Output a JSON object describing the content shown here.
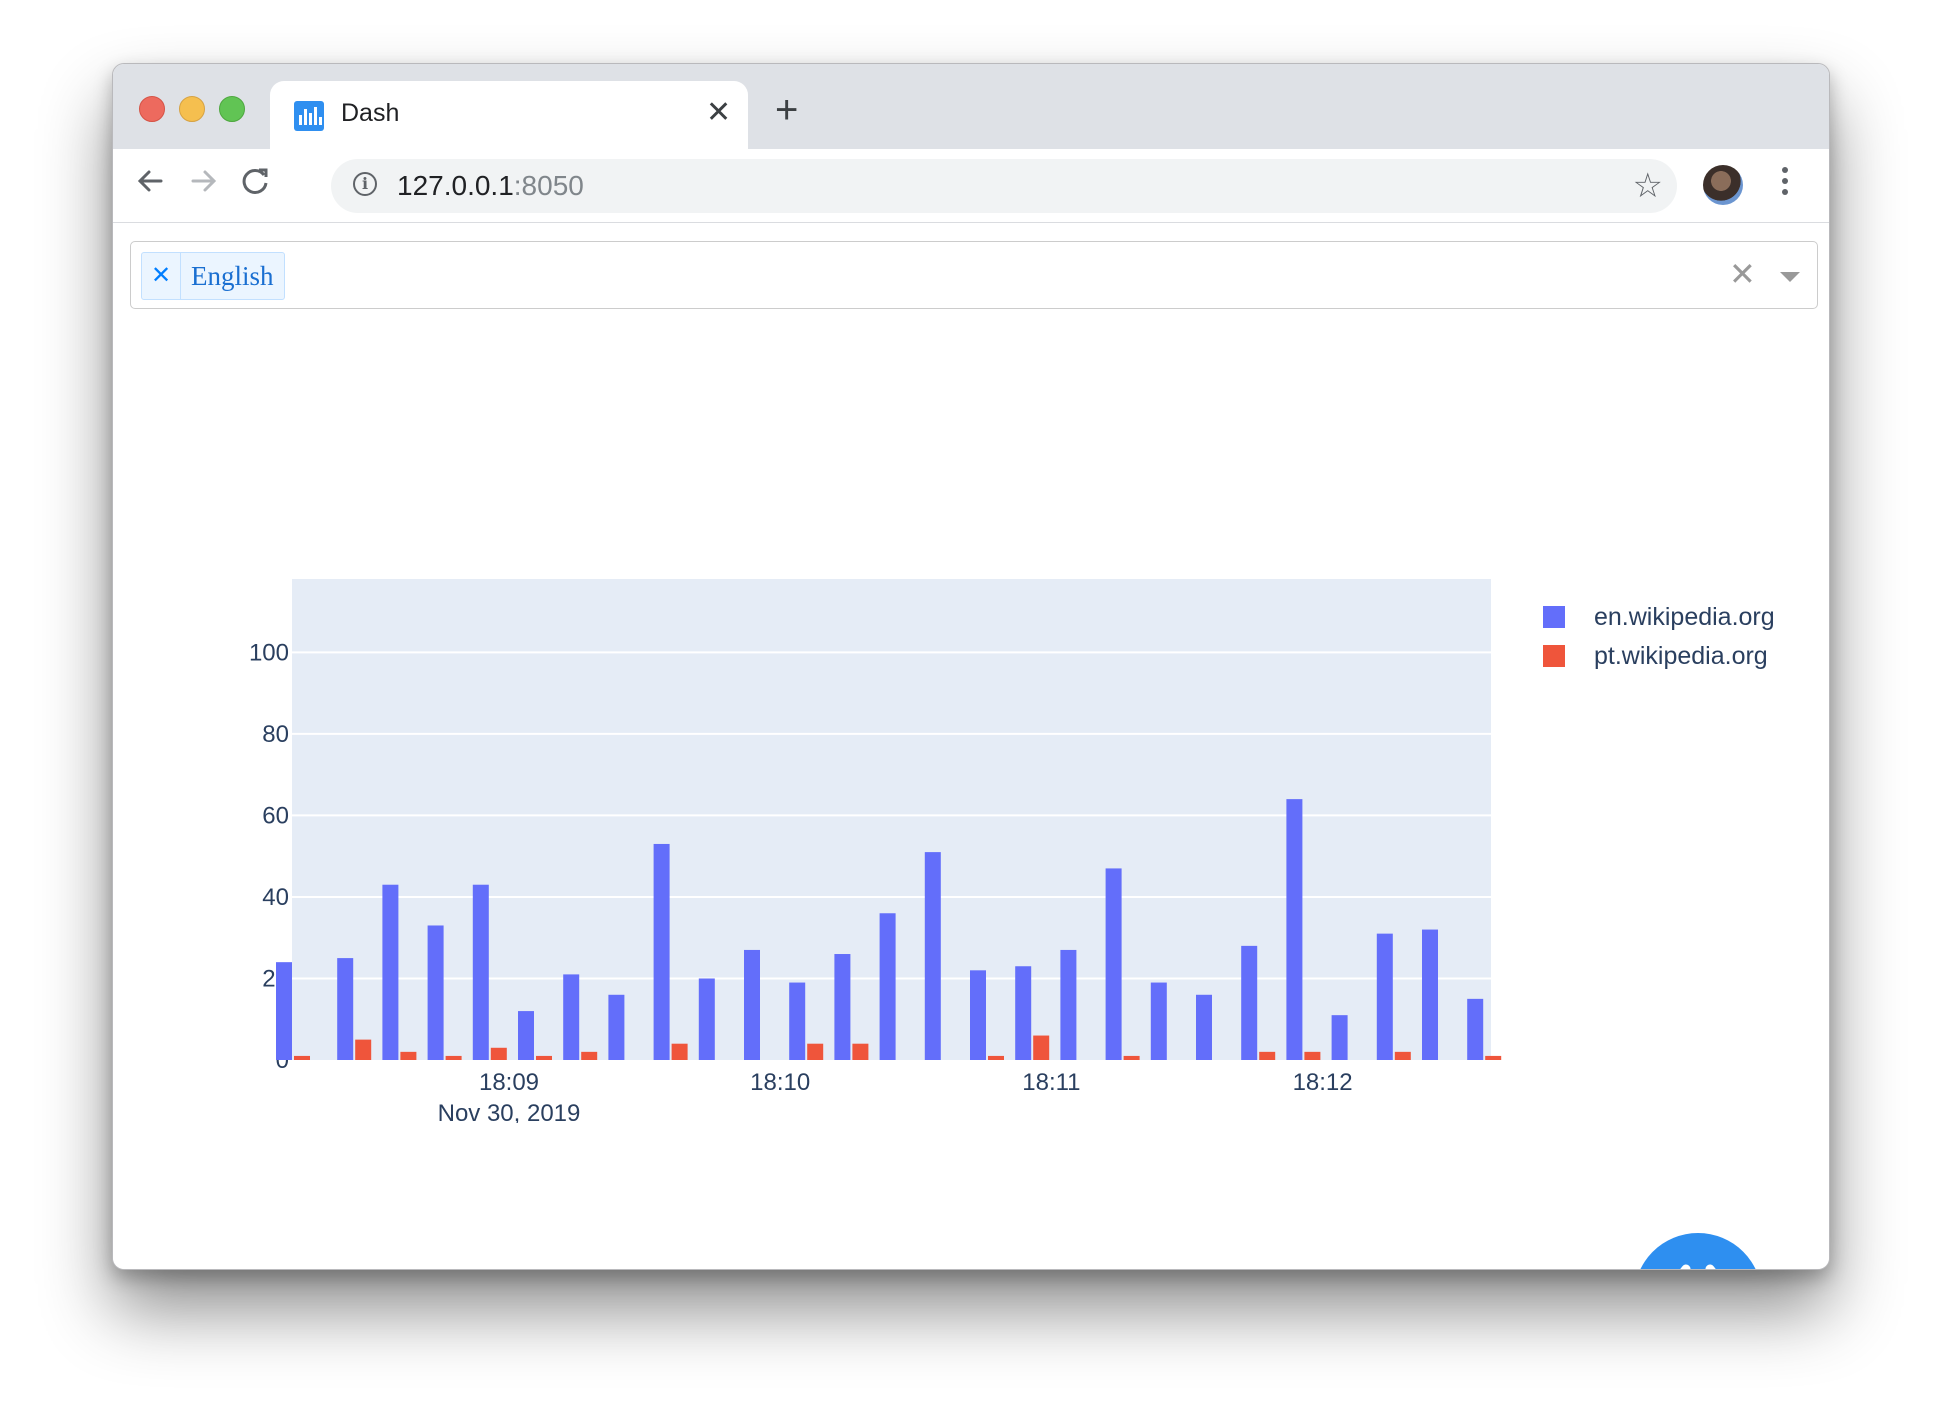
{
  "browser": {
    "tab_title": "Dash",
    "url_host": "127.0.0.1",
    "url_port": ":8050"
  },
  "dropdown": {
    "selected_chip": "English"
  },
  "colors": {
    "series_en": "#636efa",
    "series_pt": "#ef553b",
    "plot_bg": "#e5ecf6",
    "fab": "#2e8ff0"
  },
  "icons": [
    "back-arrow-icon",
    "forward-arrow-icon",
    "reload-icon",
    "info-icon",
    "star-icon",
    "menu-icon",
    "close-icon",
    "plus-icon",
    "code-icon"
  ],
  "chart_data": {
    "type": "bar",
    "barmode": "group",
    "series": [
      {
        "name": "en.wikipedia.org",
        "values": [
          24,
          25,
          43,
          33,
          43,
          12,
          21,
          16,
          53,
          20,
          27,
          19,
          26,
          36,
          51,
          22,
          23,
          27,
          47,
          19,
          16,
          28,
          64,
          11,
          31,
          32,
          15
        ]
      },
      {
        "name": "pt.wikipedia.org",
        "values": [
          1,
          5,
          2,
          1,
          3,
          1,
          2,
          0,
          4,
          0,
          0,
          4,
          4,
          0,
          0,
          1,
          6,
          0,
          1,
          0,
          0,
          2,
          2,
          0,
          2,
          0,
          1
        ]
      }
    ],
    "x_start_tick_offset": 0,
    "x_tick_labels": [
      "18:09",
      "18:10",
      "18:11",
      "18:12"
    ],
    "x_tick_indices": [
      5,
      11,
      17,
      23
    ],
    "x_date_label": "Nov 30, 2019",
    "y_ticks": [
      0,
      20,
      40,
      60,
      80,
      100
    ],
    "ylim": [
      0,
      118
    ],
    "legend_position": "top-right",
    "grid": true
  }
}
